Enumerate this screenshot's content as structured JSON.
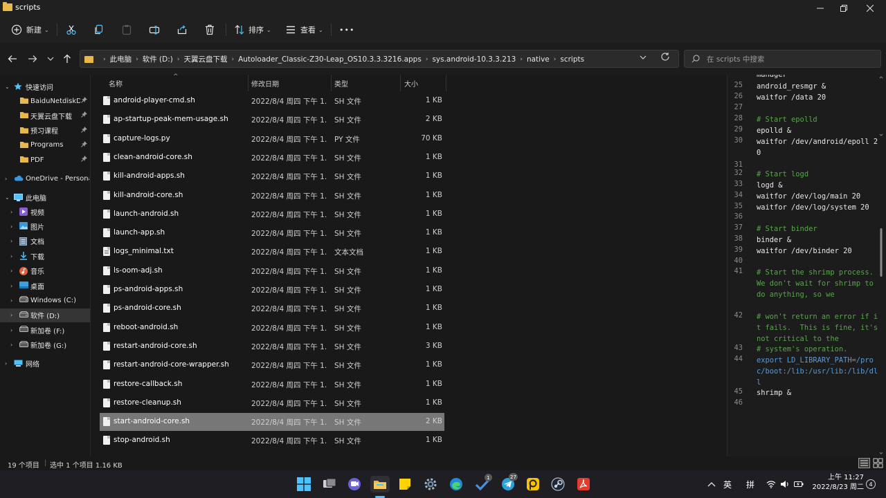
{
  "window": {
    "title": "scripts"
  },
  "toolbar": {
    "new_label": "新建",
    "sort_label": "排序",
    "view_label": "查看",
    "more_label": "•••"
  },
  "address": {
    "crumbs": [
      "此电脑",
      "软件 (D:)",
      "天翼云盘下载",
      "Autoloader_Classic-Z30-Leap_OS10.3.3.3216.apps",
      "sys.android-10.3.3.213",
      "native",
      "scripts"
    ],
    "search_placeholder": "在 scripts 中搜索"
  },
  "nav": {
    "quick_access": "快速访问",
    "quick_items": [
      "BaiduNetdiskD",
      "天翼云盘下载",
      "预习课程",
      "Programs",
      "PDF"
    ],
    "onedrive": "OneDrive - Personal",
    "this_pc": "此电脑",
    "pc_items": [
      "视频",
      "图片",
      "文档",
      "下载",
      "音乐",
      "桌面",
      "Windows (C:)",
      "软件 (D:)",
      "新加卷 (F:)",
      "新加卷 (G:)"
    ],
    "network": "网络"
  },
  "columns": {
    "name": "名称",
    "date": "修改日期",
    "type": "类型",
    "size": "大小"
  },
  "files": [
    {
      "name": "android-player-cmd.sh",
      "date": "2022/8/4 周四 下午 1...",
      "type": "SH 文件",
      "size": "1 KB"
    },
    {
      "name": "ap-startup-peak-mem-usage.sh",
      "date": "2022/8/4 周四 下午 1...",
      "type": "SH 文件",
      "size": "2 KB"
    },
    {
      "name": "capture-logs.py",
      "date": "2022/8/4 周四 下午 1...",
      "type": "PY 文件",
      "size": "70 KB"
    },
    {
      "name": "clean-android-core.sh",
      "date": "2022/8/4 周四 下午 1...",
      "type": "SH 文件",
      "size": "1 KB"
    },
    {
      "name": "kill-android-apps.sh",
      "date": "2022/8/4 周四 下午 1...",
      "type": "SH 文件",
      "size": "1 KB"
    },
    {
      "name": "kill-android-core.sh",
      "date": "2022/8/4 周四 下午 1...",
      "type": "SH 文件",
      "size": "1 KB"
    },
    {
      "name": "launch-android.sh",
      "date": "2022/8/4 周四 下午 1...",
      "type": "SH 文件",
      "size": "1 KB"
    },
    {
      "name": "launch-app.sh",
      "date": "2022/8/4 周四 下午 1...",
      "type": "SH 文件",
      "size": "1 KB"
    },
    {
      "name": "logs_minimal.txt",
      "date": "2022/8/4 周四 下午 1...",
      "type": "文本文档",
      "size": "1 KB"
    },
    {
      "name": "ls-oom-adj.sh",
      "date": "2022/8/4 周四 下午 1...",
      "type": "SH 文件",
      "size": "1 KB"
    },
    {
      "name": "ps-android-apps.sh",
      "date": "2022/8/4 周四 下午 1...",
      "type": "SH 文件",
      "size": "1 KB"
    },
    {
      "name": "ps-android-core.sh",
      "date": "2022/8/4 周四 下午 1...",
      "type": "SH 文件",
      "size": "1 KB"
    },
    {
      "name": "reboot-android.sh",
      "date": "2022/8/4 周四 下午 1...",
      "type": "SH 文件",
      "size": "1 KB"
    },
    {
      "name": "restart-android-core.sh",
      "date": "2022/8/4 周四 下午 1...",
      "type": "SH 文件",
      "size": "3 KB"
    },
    {
      "name": "restart-android-core-wrapper.sh",
      "date": "2022/8/4 周四 下午 1...",
      "type": "SH 文件",
      "size": "1 KB"
    },
    {
      "name": "restore-callback.sh",
      "date": "2022/8/4 周四 下午 1...",
      "type": "SH 文件",
      "size": "1 KB"
    },
    {
      "name": "restore-cleanup.sh",
      "date": "2022/8/4 周四 下午 1...",
      "type": "SH 文件",
      "size": "1 KB"
    },
    {
      "name": "start-android-core.sh",
      "date": "2022/8/4 周四 下午 1...",
      "type": "SH 文件",
      "size": "2 KB"
    },
    {
      "name": "stop-android.sh",
      "date": "2022/8/4 周四 下午 1...",
      "type": "SH 文件",
      "size": "1 KB"
    }
  ],
  "selected_file_index": 17,
  "preview": {
    "lines": [
      {
        "n": "",
        "code": "manager",
        "cls": ""
      },
      {
        "n": "25",
        "code": "android_resmgr &",
        "cls": ""
      },
      {
        "n": "26",
        "code": "waitfor /data 20",
        "cls": ""
      },
      {
        "n": "27",
        "code": "",
        "cls": ""
      },
      {
        "n": "28",
        "code": "# Start epolld",
        "cls": "comment"
      },
      {
        "n": "29",
        "code": "epolld &",
        "cls": ""
      },
      {
        "n": "30",
        "code": "waitfor /dev/android/epoll 20",
        "cls": ""
      },
      {
        "n": "31",
        "code": "",
        "cls": ""
      },
      {
        "n": "32",
        "code": "# Start logd",
        "cls": "comment"
      },
      {
        "n": "33",
        "code": "logd &",
        "cls": ""
      },
      {
        "n": "34",
        "code": "waitfor /dev/log/main 20",
        "cls": ""
      },
      {
        "n": "35",
        "code": "waitfor /dev/log/system 20",
        "cls": ""
      },
      {
        "n": "36",
        "code": "",
        "cls": ""
      },
      {
        "n": "37",
        "code": "# Start binder",
        "cls": "comment"
      },
      {
        "n": "38",
        "code": "binder &",
        "cls": ""
      },
      {
        "n": "39",
        "code": "waitfor /dev/binder 20",
        "cls": ""
      },
      {
        "n": "40",
        "code": "",
        "cls": ""
      },
      {
        "n": "41",
        "code": "# Start the shrimp process.  We don't wait for shrimp to do anything, so we",
        "cls": "comment"
      },
      {
        "n": "42",
        "code": "# won't return an error if it fails.  This is fine, it's not critical to the",
        "cls": "comment"
      },
      {
        "n": "43",
        "code": "# system's operation.",
        "cls": "comment"
      },
      {
        "n": "44",
        "code": "export LD_LIBRARY_PATH=/proc/boot:/lib:/usr/lib:/lib/dll",
        "cls": "kw"
      },
      {
        "n": "45",
        "code": "shrimp &",
        "cls": ""
      },
      {
        "n": "46",
        "code": "",
        "cls": ""
      }
    ]
  },
  "status": {
    "count": "19 个项目",
    "selection": "选中 1 个项目  1.16 KB"
  },
  "tray": {
    "ime_lang": "英",
    "ime_mode": "拼",
    "time": "上午 11:27",
    "date": "2022/8/23 周二",
    "notification_count": "4",
    "badge_check": "1",
    "badge_telegram": "27"
  },
  "colors": {
    "accent": "#4cc2ff",
    "folder": "#e8b84a",
    "selection": "#777777"
  }
}
